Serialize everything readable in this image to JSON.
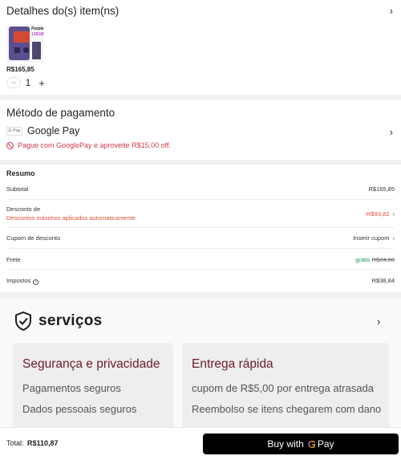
{
  "items_section": {
    "title": "Detalhes do(s) item(ns)",
    "product_label_1": "Purple",
    "product_label_2": "128GB",
    "price": "R$165,85",
    "quantity": "1",
    "minus": "−",
    "plus": "+"
  },
  "payment": {
    "title": "Método de pagamento",
    "badge": "G Pay",
    "method": "Google Pay",
    "promo": "Pague com GooglePay e aproveite R$15,00 off."
  },
  "summary": {
    "title": "Resumo",
    "rows": [
      {
        "label": "Subtotal",
        "value": "R$165,85"
      },
      {
        "label": "Desconto de",
        "sublabel": "Descontos máximos aplicados automaticamente",
        "value": "-R$93,82"
      },
      {
        "label": "Cupom de desconto",
        "value": "Inserir cupom"
      },
      {
        "label": "Frete",
        "value": "grátis",
        "old_value": "R$24,00"
      },
      {
        "label": "Impostos",
        "value": "R$38,84"
      }
    ]
  },
  "services": {
    "title": "serviços",
    "cards": [
      {
        "title": "Segurança e privacidade",
        "lines": [
          "Pagamentos seguros",
          "Dados pessoais seguros"
        ]
      },
      {
        "title": "Entrega rápida",
        "lines": [
          "cupom de R$5,00 por entrega atrasada",
          "Reembolso se itens chegarem com dano"
        ]
      }
    ]
  },
  "bottom_bar": {
    "total_label": "Total:",
    "total_value": "R$110,87",
    "buy_prefix": "Buy with",
    "buy_g": "G",
    "buy_suffix": "Pay"
  },
  "colors": {
    "accent_red": "#d23b48",
    "discount_red": "#e0503a",
    "free_green": "#1a9a5a",
    "service_title": "#6b1a2a",
    "button_bg": "#000000"
  },
  "icons": [
    "chevron-right-icon",
    "shield-check-icon",
    "no-sign-icon",
    "info-icon",
    "google-pay-badge-icon"
  ]
}
